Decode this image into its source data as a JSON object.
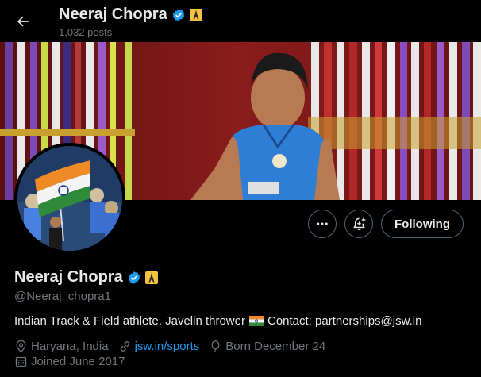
{
  "header": {
    "name": "Neeraj Chopra",
    "posts": "1,032 posts",
    "back_icon": "arrow-left-icon",
    "verified_icon": "verified-badge-icon",
    "label_icon": "eiffel-tower-badge-icon"
  },
  "actions": {
    "more_icon": "more-horizontal-icon",
    "notify_icon": "bell-plus-icon",
    "following_label": "Following"
  },
  "profile": {
    "name": "Neeraj Chopra",
    "handle": "@Neeraj_chopra1",
    "bio_text": "Indian Track & Field athlete. Javelin thrower",
    "bio_flag_icon": "india-flag-icon",
    "bio_contact": "Contact: partnerships@jsw.in",
    "location": "Haryana, India",
    "website": "jsw.in/sports",
    "born": "Born December 24",
    "joined": "Joined June 2017"
  },
  "colors": {
    "background": "#000000",
    "text_primary": "#e7e9ea",
    "text_secondary": "#71767b",
    "link": "#1d9bf0",
    "verified": "#1d9bf0",
    "label_badge": "#f5c242",
    "button_border": "#536471"
  }
}
